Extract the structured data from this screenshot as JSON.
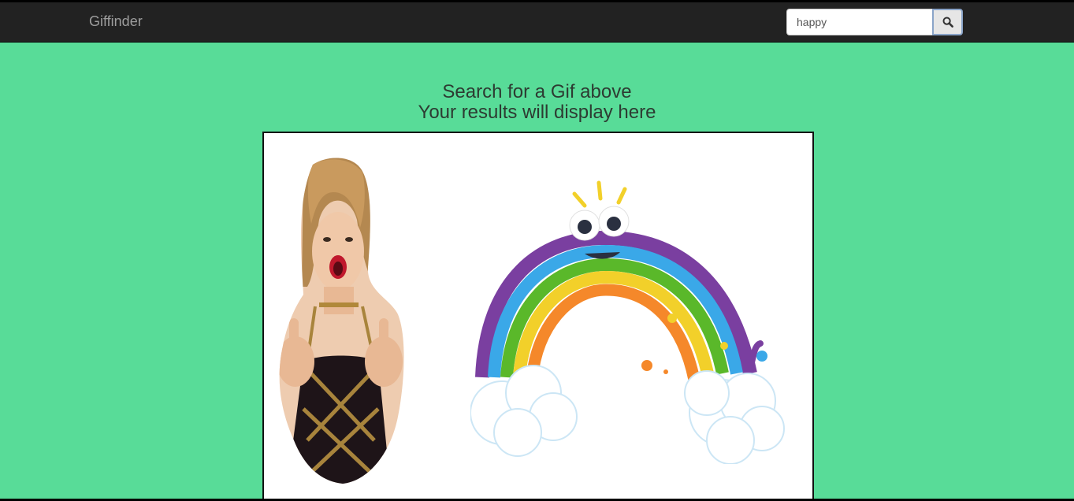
{
  "app": {
    "brand": "Giffinder"
  },
  "search": {
    "value": "happy",
    "button_icon": "search-icon"
  },
  "main": {
    "line1": "Search for a Gif above",
    "line2": "Your results will display here"
  },
  "results": [
    {
      "icon": "woman-thumbs-up-gif"
    },
    {
      "icon": "smiling-rainbow-gif"
    }
  ],
  "colors": {
    "page_background": "#58dc98",
    "navbar": "#222222",
    "brand_text": "#9d9d9d",
    "heading_text": "#2d3b32",
    "results_background": "#ffffff"
  }
}
